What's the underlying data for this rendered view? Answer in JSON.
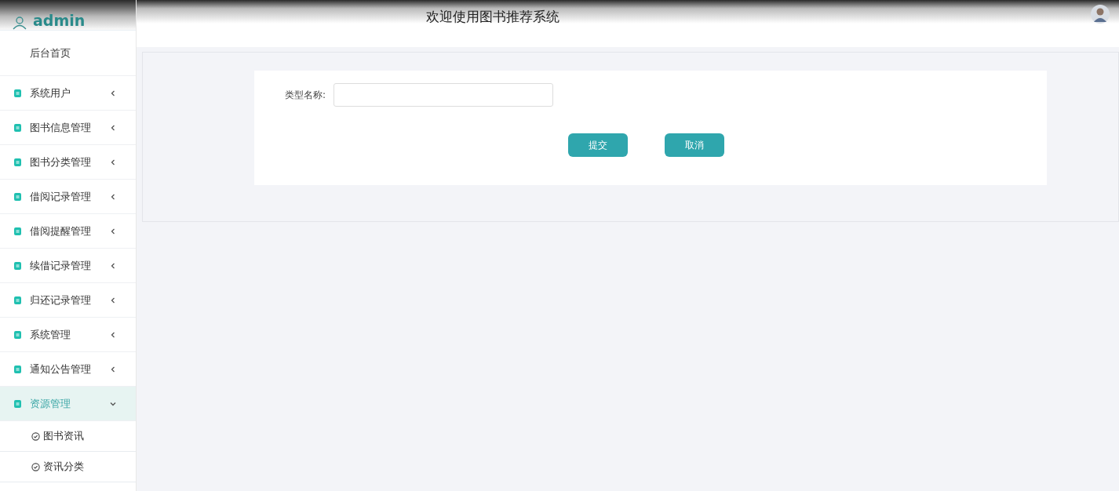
{
  "sidebar": {
    "user": "admin",
    "home": "后台首页",
    "items": [
      {
        "label": "系统用户",
        "expanded": false
      },
      {
        "label": "图书信息管理",
        "expanded": false
      },
      {
        "label": "图书分类管理",
        "expanded": false
      },
      {
        "label": "借阅记录管理",
        "expanded": false
      },
      {
        "label": "借阅提醒管理",
        "expanded": false
      },
      {
        "label": "续借记录管理",
        "expanded": false
      },
      {
        "label": "归还记录管理",
        "expanded": false
      },
      {
        "label": "系统管理",
        "expanded": false
      },
      {
        "label": "通知公告管理",
        "expanded": false
      },
      {
        "label": "资源管理",
        "expanded": true,
        "children": [
          {
            "label": "图书资讯"
          },
          {
            "label": "资讯分类"
          }
        ]
      }
    ]
  },
  "header": {
    "title": "欢迎使用图书推荐系统"
  },
  "form": {
    "fields": [
      {
        "label": "类型名称:"
      }
    ],
    "buttons": [
      "提交",
      "取消"
    ]
  }
}
